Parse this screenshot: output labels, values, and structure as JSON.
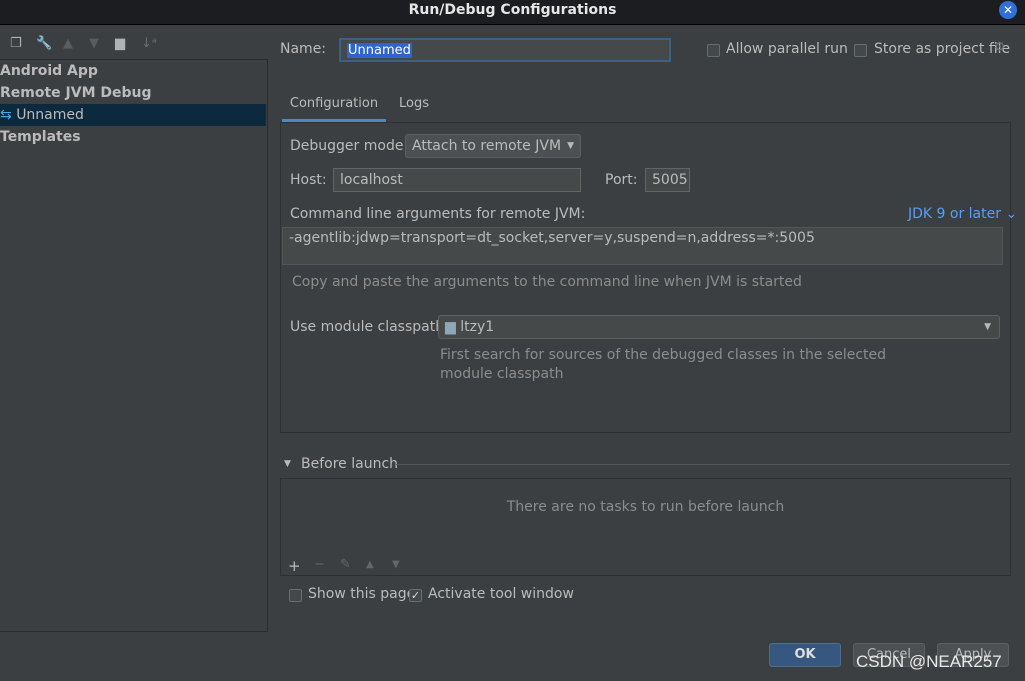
{
  "window": {
    "title": "Run/Debug Configurations"
  },
  "tree": {
    "items": [
      {
        "label": "Android App"
      },
      {
        "label": "Remote JVM Debug"
      },
      {
        "label": "Unnamed"
      },
      {
        "label": "Templates"
      }
    ]
  },
  "name": {
    "label": "Name:",
    "value": "Unnamed"
  },
  "options": {
    "parallel": "Allow parallel run",
    "store": "Store as project file"
  },
  "tabs": [
    {
      "label": "Configuration"
    },
    {
      "label": "Logs"
    }
  ],
  "config": {
    "debugger_label": "Debugger mode:",
    "debugger_value": "Attach to remote JVM",
    "host_label": "Host:",
    "host_value": "localhost",
    "port_label": "Port:",
    "port_value": "5005",
    "cmd_label": "Command line arguments for remote JVM:",
    "jdk_link": "JDK 9 or later",
    "cmd_value": "-agentlib:jdwp=transport=dt_socket,server=y,suspend=n,address=*:5005",
    "cmd_hint": "Copy and paste the arguments to the command line when JVM is started",
    "module_label": "Use module classpath:",
    "module_value": "ltzy1",
    "module_hint1": "First search for sources of the debugged classes in the selected",
    "module_hint2": "module classpath"
  },
  "before_launch": {
    "title": "Before launch",
    "empty": "There are no tasks to run before launch"
  },
  "footer": {
    "show_page": "Show this page",
    "activate": "Activate tool window",
    "activate_checked": true,
    "show_checked": false,
    "ok": "OK",
    "cancel": "Cancel",
    "apply": "Apply"
  },
  "watermark": "CSDN @NEAR257"
}
